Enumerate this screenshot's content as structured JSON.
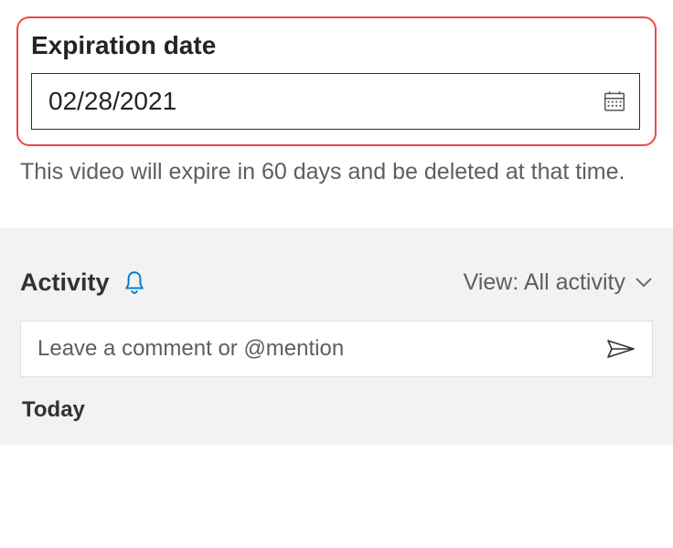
{
  "expiration": {
    "label": "Expiration date",
    "value": "02/28/2021",
    "help_text": "This video will expire in 60 days and be deleted at that time."
  },
  "activity": {
    "title": "Activity",
    "view_label": "View: All activity",
    "comment_placeholder": "Leave a comment or @mention",
    "today_label": "Today"
  }
}
